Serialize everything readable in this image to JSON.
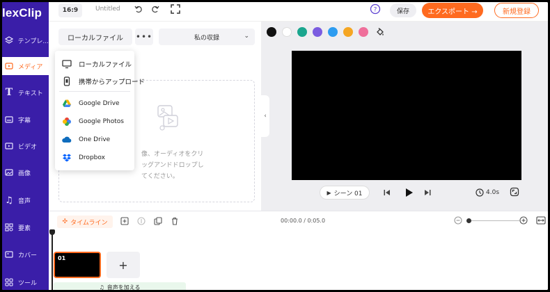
{
  "app": {
    "logo_text": "lexClip"
  },
  "sidebar": {
    "items": [
      {
        "label": "テンプレ..."
      },
      {
        "label": "メディア"
      },
      {
        "label": "テキスト"
      },
      {
        "label": "字幕"
      },
      {
        "label": "ビデオ"
      },
      {
        "label": "画像"
      },
      {
        "label": "音声"
      },
      {
        "label": "要素"
      },
      {
        "label": "カバー"
      },
      {
        "label": "ツール"
      }
    ]
  },
  "topbar": {
    "ratio": "16:9",
    "doc_title": "Untitled",
    "save_label": "保存",
    "export_label": "エクスポート →",
    "signup_label": "新規登録"
  },
  "panel": {
    "local_file_label": "ローカルファイル",
    "more_label": "•••",
    "collection_label": "私の収録",
    "drop_text_line1": "像、オーディオをクリ",
    "drop_text_line2": "ッグアンドドロップし",
    "drop_text_line3": "てください。"
  },
  "menu": {
    "items": [
      {
        "label": "ローカルファイル",
        "icon": "monitor-icon"
      },
      {
        "label": "携帯からアップロード",
        "icon": "phone-icon"
      },
      {
        "label": "Google Drive",
        "icon": "google-drive-icon"
      },
      {
        "label": "Google Photos",
        "icon": "google-photos-icon"
      },
      {
        "label": "One Drive",
        "icon": "onedrive-icon"
      },
      {
        "label": "Dropbox",
        "icon": "dropbox-icon"
      }
    ]
  },
  "palette": {
    "colors": [
      "#111111",
      "#ffffff",
      "#1aa68e",
      "#7b5ce0",
      "#2d9cf0",
      "#f5a623",
      "#ef6f9b"
    ]
  },
  "player": {
    "scene_label": "シーン 01",
    "duration": "4.0s"
  },
  "timeline": {
    "label": "タイムライン",
    "timecode": "00:00.0 / 0:05.0",
    "clip_label": "01",
    "add_label": "+",
    "audio_label": "音声を加える"
  },
  "colors": {
    "brand_sidebar": "#3a1ea8",
    "accent": "#ff6a1f"
  }
}
